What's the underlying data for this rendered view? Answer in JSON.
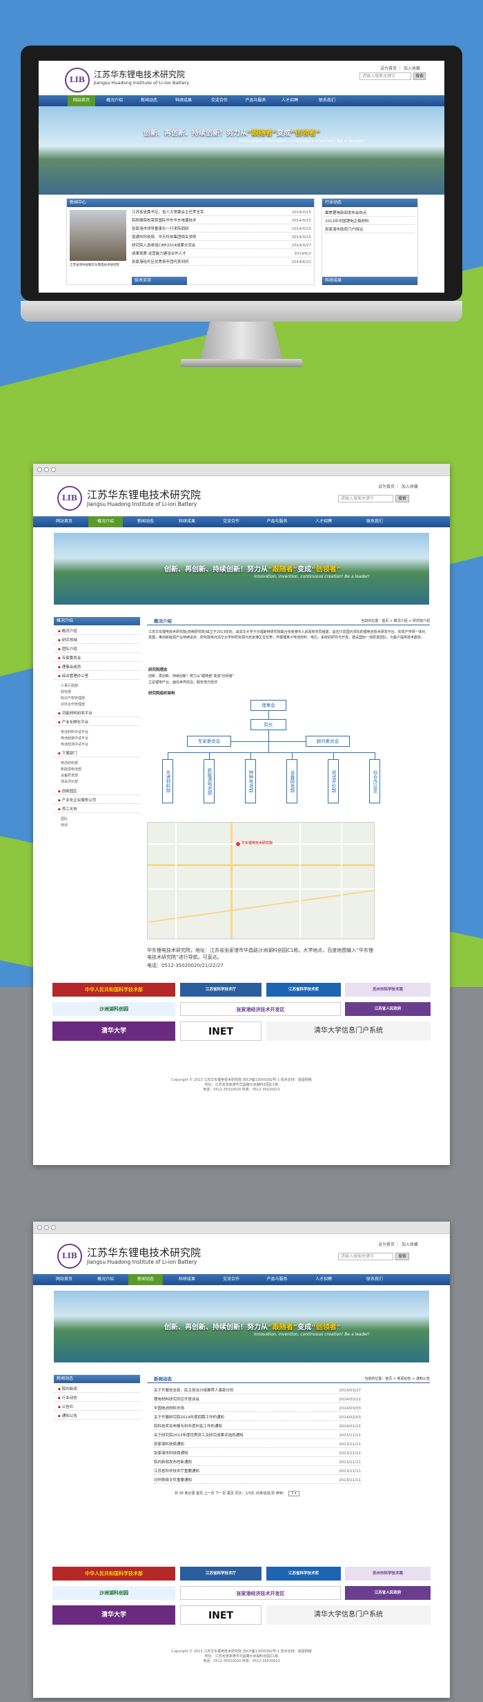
{
  "site": {
    "logo_text": "LIB",
    "name_cn": "江苏华东锂电技术研究院",
    "name_en": "Jiangsu Huadong Institute of Li-ion Battery",
    "top_links": "设为首页 ｜ 加入收藏",
    "search_placeholder": "请输入搜索关键字",
    "search_button": "搜索"
  },
  "nav": [
    "网站首页",
    "概况介绍",
    "新闻动态",
    "科研成果",
    "交流合作",
    "产品与服务",
    "人才招聘",
    "联系我们"
  ],
  "banner": {
    "slogan_prefix": "创新、再创新、持续创新！努力从",
    "word1": "“跟随者”",
    "word2": "变成",
    "word3": "“创领者”",
    "english": "Innovation, invention, continuous creation! Be a leader!"
  },
  "home": {
    "news_title": "新闻中心",
    "photo_caption": "江苏省领导视察华东锂电技术研究院",
    "news": [
      {
        "text": "江苏省省委书记、省人大常委会主任罗志军",
        "date": "2014/0/15"
      },
      {
        "text": "院附属院校荣获国际华东华东电镀技术",
        "date": "2014/0/15"
      },
      {
        "text": "张家港市领导董事长一行来院调研",
        "date": "2014/0/15"
      },
      {
        "text": "南通市科技局、中天科技集团相关领导",
        "date": "2014/0/15"
      },
      {
        "text": "研究院入选参加CIBF2014成果交流会",
        "date": "2014/0/27"
      },
      {
        "text": "成果观摩 运营能力建设合作人才",
        "date": "2014/6/2"
      },
      {
        "text": "张家港经开区优秀青年团代表到所",
        "date": "2014/6/21"
      }
    ],
    "industry_title": "行业动态",
    "industry": [
      "聚焦锂电新闻发布会热点",
      "2013年中国锂电正极材料",
      "张家港市政府门户网站"
    ],
    "tech_title": "技术支持",
    "research_title": "科研成果"
  },
  "about": {
    "sidebar_title": "概况介绍",
    "sidebar": [
      "概况介绍",
      "研究领域",
      "团队介绍",
      "专家委员会",
      "理事会成员",
      "综合管理办公室"
    ],
    "sidebar_sub1": [
      "人事行政部",
      "财务部",
      "知识产权管理部",
      "对外合作管理部"
    ],
    "sidebar_more": [
      "功能材料研发平台",
      "产业化孵化平台"
    ],
    "sidebar_sub2": [
      "电池材料中试平台",
      "电池组装中试平台",
      "电池检测中试平台"
    ],
    "sidebar_dept": "下属部门",
    "sidebar_sub3": [
      "电池材料部",
      "新能源电池部",
      "设备研发部",
      "测试评价部"
    ],
    "sidebar_more2": [
      "创新园区",
      "产业化企业服务公司",
      "员工天地"
    ],
    "sidebar_sub4": [
      "团队",
      "培训"
    ],
    "section_title": "概况介绍",
    "breadcrumb": "当前的位置：首页 > 概况介绍 > 研究院介绍",
    "intro": "江苏华东锂电技术研究院(简称研究院)成立于2013年初，由清华大学卡尔福斯特研究院联合张家港市人民政府共同组建，旨在打造国内领先的锂电池技术研发平台，实现产学研一体化发展，推动新能源产业持续进步。研究院依托清华大学科研资源与张家港区位优势，开展锂离子电池材料、电芯、系统的研究与开发，建设国际一流研发团队，为客户提供技术服务。",
    "philosophy_title": "研究院理念",
    "philosophy": "创新、再创新、持续创新！努力从\"跟随者\"变成\"创领者\"",
    "philosophy2": "立足锂电产业，面向世界前沿，服务地方经济",
    "org_title": "研究院组织架构",
    "org_top": "理事会",
    "org_mid": "院长",
    "org_left": "专家委员会",
    "org_right": "顾问委员会",
    "org_depts": [
      "先进材料部",
      "新能源电池部",
      "特种电池部",
      "设备研发部",
      "测试评价部",
      "综合办公室"
    ],
    "address": "华东锂电技术研究院，地址：江苏省张家港市华昌路沙洲湖科创园C1栋。大学地点，百度地图输入“华东锂电技术研究院”进行导航，可直达。",
    "phone": "电话：0512-35020020/21/22/27",
    "map_label": "华东锂电技术研究院"
  },
  "links": [
    "中华人民共和国科学技术部",
    "江苏省科学技术厅",
    "江苏省科学技术奖",
    "苏州市科学技术局",
    "沙洲湖科创园",
    "张家港经济技术开发区",
    "江苏省人民政府",
    "清华大学",
    "INET",
    "清华大学信息门户系统"
  ],
  "footer": {
    "line1": "Copyright © 2013 江苏华东锂电技术研究院 苏ICP备13000392号-1 技术支持：易盟网络",
    "line2": "地址：江苏省张家港市华昌路沙洲湖科创园C1栋",
    "line3": "电话：0512-35020020 传真：0512-35020022"
  },
  "newspage": {
    "sidebar_title": "新闻动态",
    "sidebar": [
      "院内新闻",
      "行业动态",
      "公告栏",
      "通知公告"
    ],
    "section_title": "新闻动态",
    "breadcrumb": "当前的位置：首页 > 新闻动态 > 通知公告",
    "items": [
      {
        "text": "关于开展党支部、民主党派分组推荐人事部分的",
        "date": "2014/03/27"
      },
      {
        "text": "锂电材料研究所召开座谈会",
        "date": "2014/03/12"
      },
      {
        "text": "中国电池材料市场",
        "date": "2014/03/03"
      },
      {
        "text": "关于开展研究院2014年度招聘工作的通知",
        "date": "2014/02/03"
      },
      {
        "text": "院科技奖及申报专利年度补贴工作的通知",
        "date": "2014/01/15"
      },
      {
        "text": "关于研究院2013年度优秀员工及研究成果评选的通知",
        "date": "2013/11/11"
      },
      {
        "text": "张家港科技局通知",
        "date": "2013/11/11"
      },
      {
        "text": "张家港市科技局通知",
        "date": "2013/11/11"
      },
      {
        "text": "院内新闻发布的新通知",
        "date": "2013/11/11"
      },
      {
        "text": "江苏省科学技术厅重要通知",
        "date": "2013/11/11"
      },
      {
        "text": "对外联络文件重要通知",
        "date": "2013/11/11"
      }
    ],
    "pager": "共 30 条记录 首页 上一页 下一页 尾页 页次：1/3页 20条信息/页 转到：",
    "pager_select": "1"
  }
}
